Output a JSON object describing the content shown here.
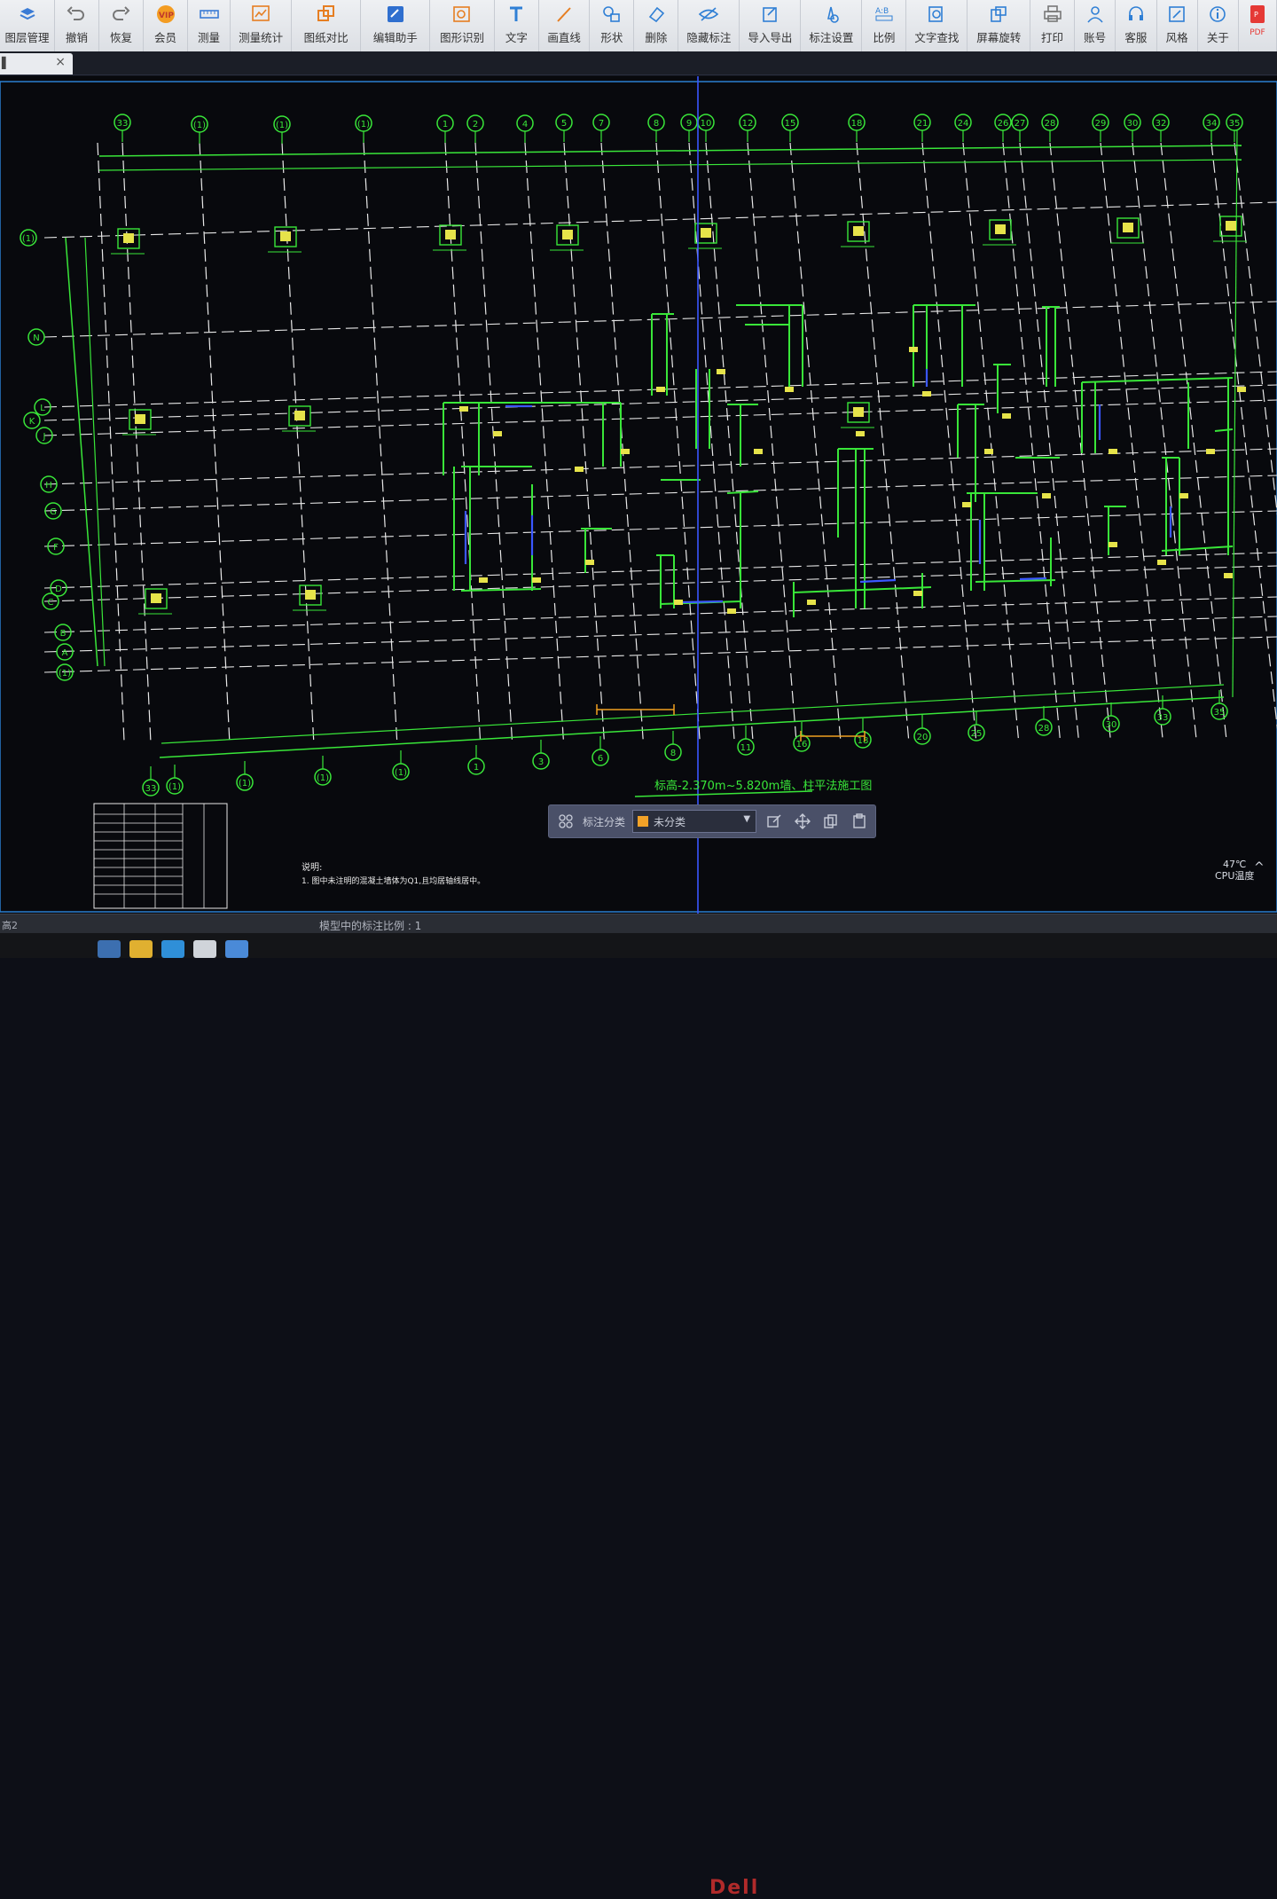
{
  "toolbar": {
    "items": [
      {
        "label": "图层管理",
        "icon": "layers-icon"
      },
      {
        "label": "撤销",
        "icon": "undo-icon"
      },
      {
        "label": "恢复",
        "icon": "redo-icon"
      },
      {
        "label": "会员",
        "icon": "vip-icon"
      },
      {
        "label": "测量",
        "icon": "ruler-icon"
      },
      {
        "label": "测量统计",
        "icon": "measure-stats-icon"
      },
      {
        "label": "图纸对比",
        "icon": "compare-icon"
      },
      {
        "label": "编辑助手",
        "icon": "edit-assistant-icon"
      },
      {
        "label": "图形识别",
        "icon": "shape-recognition-icon"
      },
      {
        "label": "文字",
        "icon": "text-icon"
      },
      {
        "label": "画直线",
        "icon": "line-icon"
      },
      {
        "label": "形状",
        "icon": "shape-icon"
      },
      {
        "label": "删除",
        "icon": "eraser-icon"
      },
      {
        "label": "隐藏标注",
        "icon": "hide-eye-icon"
      },
      {
        "label": "导入导出",
        "icon": "import-export-icon"
      },
      {
        "label": "标注设置",
        "icon": "annotation-settings-icon"
      },
      {
        "label": "比例",
        "icon": "ratio-icon"
      },
      {
        "label": "文字查找",
        "icon": "text-search-icon"
      },
      {
        "label": "屏幕旋转",
        "icon": "rotate-screen-icon"
      },
      {
        "label": "打印",
        "icon": "print-icon"
      },
      {
        "label": "账号",
        "icon": "account-icon"
      },
      {
        "label": "客服",
        "icon": "headset-icon"
      },
      {
        "label": "风格",
        "icon": "style-icon"
      },
      {
        "label": "关于",
        "icon": "info-icon"
      },
      {
        "label": "PDF",
        "icon": "pdf-icon"
      }
    ]
  },
  "tab": {
    "close_glyph": "×"
  },
  "drawing": {
    "top_axes": [
      "33",
      "(1)",
      "(1)",
      "(1)",
      "1",
      "2",
      "4",
      "5",
      "7",
      "8",
      "9",
      "10",
      "12",
      "15",
      "18",
      "21",
      "24",
      "26",
      "27",
      "28",
      "29",
      "30",
      "32",
      "34",
      "35"
    ],
    "bottom_axes": [
      "33",
      "(1)",
      "(1)",
      "(1)",
      "(1)",
      "1",
      "3",
      "6",
      "8",
      "11",
      "16",
      "18",
      "20",
      "25",
      "28",
      "30",
      "33",
      "35"
    ],
    "left_axes": [
      "(1)",
      "N",
      "L",
      "K",
      "J",
      "H",
      "G",
      "F",
      "D",
      "C",
      "B",
      "A",
      "(1)"
    ],
    "title": "标高-2.370m~5.820m墙、柱平法施工图",
    "notes_heading": "说明:",
    "notes_line": "1. 图中未注明的混凝土墙体为Q1,且均居轴线居中。"
  },
  "floating_bar": {
    "label": "标注分类",
    "selected": "未分类",
    "swatch_color": "#f2a228",
    "icons": [
      "grid-icon",
      "edit-icon",
      "move-icon",
      "copy-icon",
      "paste-icon"
    ]
  },
  "status": {
    "left": "高2",
    "scale_text": "模型中的标注比例 : 1"
  },
  "system": {
    "cpu_temp": "47℃",
    "cpu_label": "CPU温度",
    "brand": "Dell"
  },
  "colors": {
    "axis_green": "#39e639",
    "grid_white": "#e8e8e8",
    "column_yellow": "#e6e34a",
    "blue_line": "#3b57ff",
    "dim_orange": "#f0a020"
  }
}
